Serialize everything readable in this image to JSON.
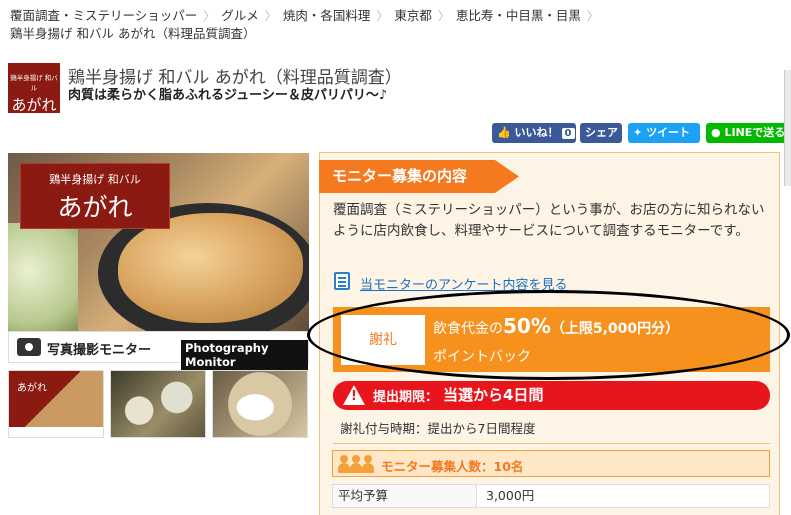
{
  "breadcrumb": [
    {
      "label": "覆面調査・ミステリーショッパー"
    },
    {
      "label": "グルメ"
    },
    {
      "label": "焼肉・各国料理"
    },
    {
      "label": "東京都"
    },
    {
      "label": "恵比寿・中目黒・目黒"
    },
    {
      "label": "鶏半身揚げ 和バル あがれ（料理品質調査）"
    }
  ],
  "shop": {
    "logo_small": "鶏半身揚げ 和バル",
    "logo_big": "あがれ",
    "name": "鶏半身揚げ 和バル あがれ（料理品質調査）",
    "catch": "肉質は柔らかく脂あふれるジューシー＆皮パリパリ〜♪"
  },
  "social": {
    "like_label": "いいね！",
    "like_count": "0",
    "share_label": "シェア",
    "tweet_label": "ツイート",
    "line_label": "LINEで送る"
  },
  "photo": {
    "sign_small": "鶏半身揚げ 和バル",
    "sign_big": "あがれ",
    "caption": "写真撮影モニター",
    "caption_en": "Photography Monitor",
    "thumb1_text": "あがれ"
  },
  "monitor": {
    "header": "モニター募集の内容",
    "description": "覆面調査（ミステリーショッパー）という事が、お店の方に知られないように店内飲食し、料理やサービスについて調査するモニターです。",
    "survey_link": "当モニターのアンケート内容を見る",
    "reward_label": "謝礼",
    "reward_prefix": "飲食代金の",
    "reward_percent": "50%",
    "reward_cap": "（上限5,000円分）",
    "reward_line2": "ポイントバック",
    "deadline_label": "提出期限：",
    "deadline_value": "当選から4日間",
    "payout_timing": "謝礼付与時期：提出から7日間程度",
    "headcount": "モニター募集人数：10名",
    "budget_label": "平均予算",
    "budget_value": "3,000円"
  },
  "colors": {
    "accent_orange": "#f4791f",
    "reward_orange": "#f7911e",
    "deadline_red": "#e8151c",
    "shop_red": "#8a1a12",
    "link_blue": "#1a6ec0",
    "facebook": "#3b5998",
    "twitter": "#1da1f2",
    "line": "#00b900"
  }
}
